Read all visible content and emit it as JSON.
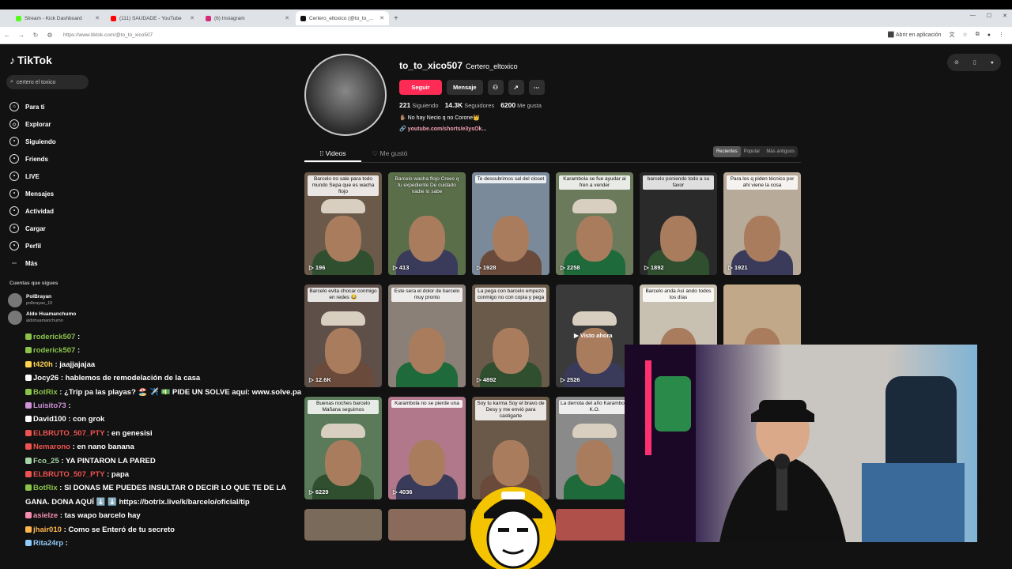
{
  "browser": {
    "tabs": [
      {
        "title": "Stream - Kick Dashboard",
        "color": "#53fc18"
      },
      {
        "title": "(111) SAUDADE - YouTube",
        "color": "#ff0000"
      },
      {
        "title": "(6) Instagram",
        "color": "#d62976"
      },
      {
        "title": "Certero_eltoxico (@to_to_...",
        "color": "#111111"
      }
    ],
    "url": "https://www.tiktok.com/@to_to_xico507",
    "open_in_app": "Abrir en aplicación"
  },
  "sidebar": {
    "logo": "TikTok",
    "search_value": "certero el toxico",
    "nav": [
      {
        "label": "Para ti",
        "icon": "home-icon"
      },
      {
        "label": "Explorar",
        "icon": "compass-icon"
      },
      {
        "label": "Siguiendo",
        "icon": "following-icon"
      },
      {
        "label": "Friends",
        "icon": "friends-icon"
      },
      {
        "label": "LIVE",
        "icon": "live-icon"
      },
      {
        "label": "Mensajes",
        "icon": "messages-icon"
      },
      {
        "label": "Actividad",
        "icon": "activity-icon"
      },
      {
        "label": "Cargar",
        "icon": "upload-icon"
      },
      {
        "label": "Perfil",
        "icon": "profile-icon"
      },
      {
        "label": "Más",
        "icon": "more-icon"
      }
    ],
    "following_header": "Cuentas que sigues",
    "accounts": [
      {
        "name": "PolBrayan",
        "handle": "polbrayan_10"
      },
      {
        "name": "Aldo Huamanchumo",
        "handle": "aldohuamanchumo"
      }
    ]
  },
  "profile": {
    "username": "to_to_xico507",
    "display_name": "Certero_eltoxico",
    "follow": "Seguir",
    "message": "Mensaje",
    "following_count": "221",
    "following_label": "Siguiendo",
    "followers_count": "14.3K",
    "followers_label": "Seguidores",
    "likes_count": "6200",
    "likes_label": "Me gusta",
    "bio": "✋🏽 No hay Necio q no Corone👑",
    "link": "youtube.com/shorts/e3ysOk..."
  },
  "content_tabs": {
    "videos": "Videos",
    "liked": "Me gustó",
    "sort": [
      "Recientes",
      "Popular",
      "Más antiguos"
    ]
  },
  "videos": [
    {
      "caption": "Barcelo no sale para todo mundo Sepa que es wacha flojo",
      "views": "196",
      "bg": "#6b5a4a",
      "cap_dark": false
    },
    {
      "caption": "Barcelo wacha flojo Crees q tu expediente De cuidado nadie lo sabe",
      "views": "413",
      "bg": "#5a6e4a",
      "cap_dark": true
    },
    {
      "caption": "Te descubrimos sal del closet",
      "views": "1928",
      "bg": "#7a8a9a",
      "cap_dark": false
    },
    {
      "caption": "Karambola se fue ayudar al fren a vender",
      "views": "2258",
      "bg": "#6a7a5a",
      "cap_dark": false
    },
    {
      "caption": "barcelo poniendo todo a su favor",
      "views": "1892",
      "bg": "#2a2a2a",
      "cap_dark": false
    },
    {
      "caption": "Para los q piden técnico por ahí viene la cosa",
      "views": "1921",
      "bg": "#b8aa98",
      "cap_dark": false
    },
    {
      "caption": "Barcelo evita chocar conmigo en redes 😂",
      "views": "12.6K",
      "bg": "#5e5048",
      "cap_dark": false
    },
    {
      "caption": "Este sera el dolor de barcelo muy pronto",
      "views": "",
      "bg": "#8a8078",
      "cap_dark": false
    },
    {
      "caption": "La pega con barcelo empezó conmigo no con copia y pega",
      "views": "4892",
      "bg": "#6a5a4a",
      "cap_dark": false
    },
    {
      "caption": "",
      "views": "2526",
      "bg": "#3a3a3a",
      "cap_dark": true
    },
    {
      "caption": "Barcelo anda Así ando todos los días",
      "views": "",
      "bg": "#c8c0b0",
      "cap_dark": false
    },
    {
      "caption": "",
      "views": "",
      "bg": "#c0a888",
      "cap_dark": false
    },
    {
      "caption": "Buenas noches barcelo Mañana seguimos",
      "views": "6229",
      "bg": "#5a7a5a",
      "cap_dark": false
    },
    {
      "caption": "Karambola no se pierde una",
      "views": "4036",
      "bg": "#b0788a",
      "cap_dark": false
    },
    {
      "caption": "Soy tu karma Soy el bravo de Desy y me envió para castigarte",
      "views": "",
      "bg": "#6a5848",
      "cap_dark": false
    },
    {
      "caption": "La derrota del año Karambola K.O.",
      "views": "",
      "bg": "#8a8a8a",
      "cap_dark": false
    }
  ],
  "watch_again": "Visto ahora",
  "chat": [
    {
      "user": "roderick507",
      "msg": ":",
      "color": "#8bc34a"
    },
    {
      "user": "roderick507",
      "msg": ":",
      "color": "#8bc34a"
    },
    {
      "user": "t420h",
      "msg": ": jaajjajajaa",
      "color": "#ffd54f"
    },
    {
      "user": "Jocy26",
      "msg": ": hablemos de remodelación de la casa",
      "color": "#ffffff"
    },
    {
      "user": "BotRix",
      "msg": ": ¿Trip pa las playas? 🏖️ ✈️ 💵 PIDE UN SOLVE aquí: www.solve.pa",
      "color": "#8bc34a"
    },
    {
      "user": "Luisito73",
      "msg": ":",
      "color": "#ce93d8"
    },
    {
      "user": "David100",
      "msg": ": con grok",
      "color": "#ffffff"
    },
    {
      "user": "ELBRUTO_507_PTY",
      "msg": ": en genesisi",
      "color": "#ef5350"
    },
    {
      "user": "Nemarono",
      "msg": ": en nano banana",
      "color": "#ef5350"
    },
    {
      "user": "Fco_25",
      "msg": ": YA PINTARON LA PARED",
      "color": "#a5d6a7"
    },
    {
      "user": "ELBRUTO_507_PTY",
      "msg": ": papa",
      "color": "#ef5350"
    },
    {
      "user": "BotRix",
      "msg": ": SI DONAS ME PUEDES INSULTAR O DECIR LO QUE TE DE LA GANA. DONA AQUÍ ⬇️ ⬇️ https://botrix.live/k/barcelo/oficial/tip",
      "color": "#8bc34a"
    },
    {
      "user": "asielze",
      "msg": ": tas wapo barcelo hay",
      "color": "#f48fb1"
    },
    {
      "user": "jhair010",
      "msg": ": Como se Enteró de tu secreto",
      "color": "#ffb74d"
    },
    {
      "user": "Rita24rp",
      "msg": ":",
      "color": "#90caf9"
    }
  ]
}
